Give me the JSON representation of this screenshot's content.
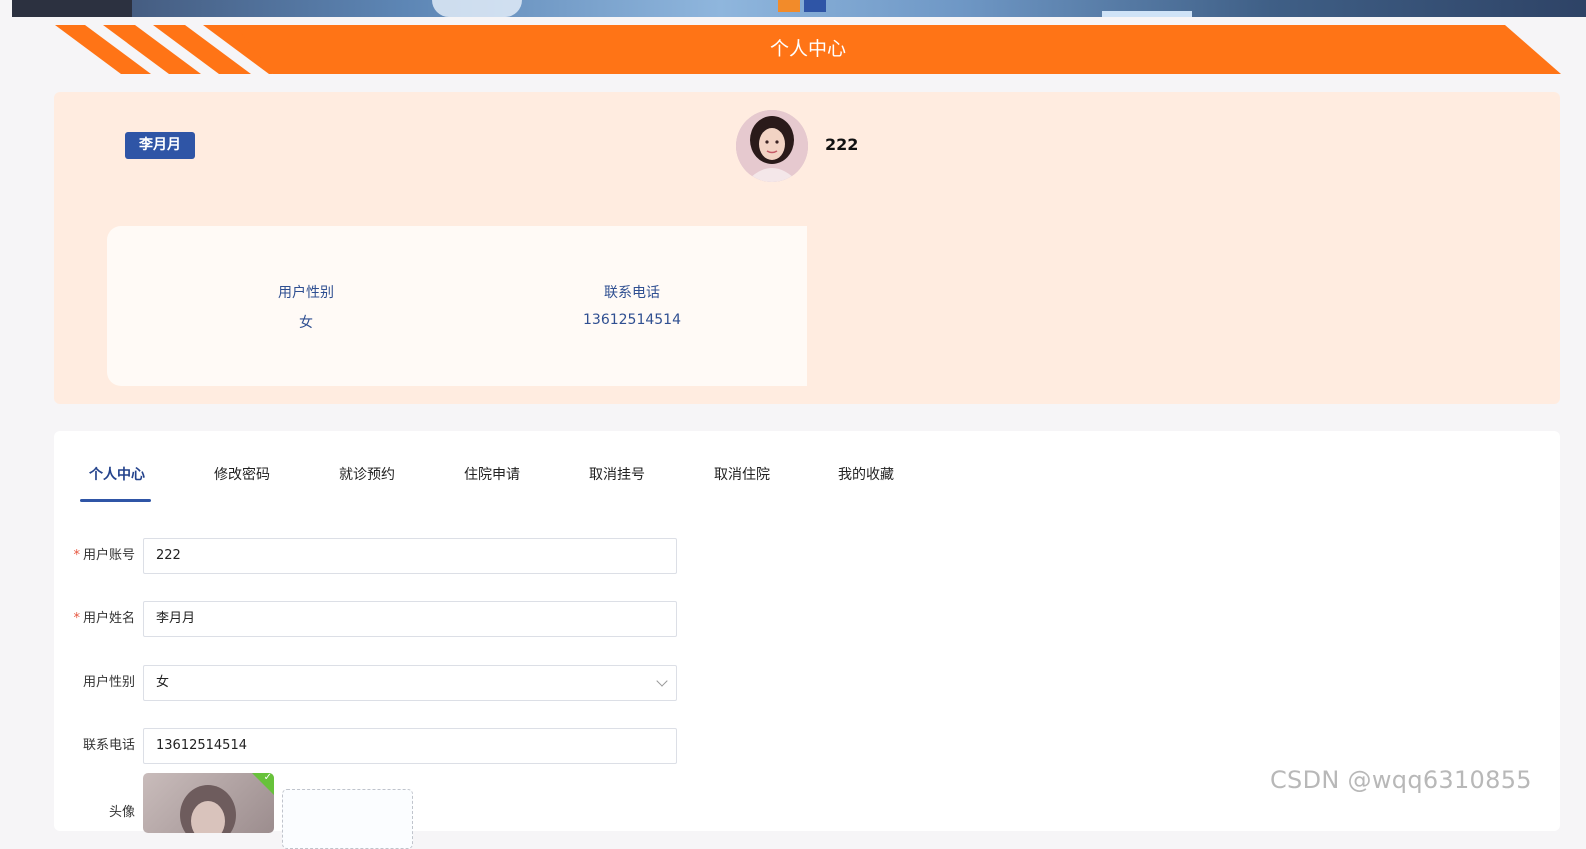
{
  "page": {
    "title": "个人中心"
  },
  "profile": {
    "name_badge": "李月月",
    "account": "222",
    "info": [
      {
        "label": "用户性别",
        "value": "女"
      },
      {
        "label": "联系电话",
        "value": "13612514514"
      }
    ]
  },
  "tabs": [
    {
      "label": "个人中心",
      "active": true
    },
    {
      "label": "修改密码",
      "active": false
    },
    {
      "label": "就诊预约",
      "active": false
    },
    {
      "label": "住院申请",
      "active": false
    },
    {
      "label": "取消挂号",
      "active": false
    },
    {
      "label": "取消住院",
      "active": false
    },
    {
      "label": "我的收藏",
      "active": false
    }
  ],
  "form": {
    "account": {
      "label": "用户账号",
      "value": "222",
      "required": "*"
    },
    "name": {
      "label": "用户姓名",
      "value": "李月月",
      "required": "*"
    },
    "gender": {
      "label": "用户性别",
      "value": "女"
    },
    "phone": {
      "label": "联系电话",
      "value": "13612514514"
    },
    "avatar": {
      "label": "头像"
    }
  },
  "watermark": "CSDN @wqq6310855",
  "colors": {
    "accent_orange": "#ff7416",
    "primary_blue": "#2f55a6",
    "card_bg": "#ffece0",
    "required_red": "#e6553e"
  }
}
